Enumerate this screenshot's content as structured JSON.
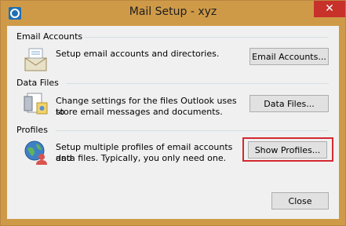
{
  "window": {
    "title": "Mail Setup - xyz",
    "close_glyph": "✕",
    "app_icon": "outlook-app-icon"
  },
  "email_accounts": {
    "group_label": "Email Accounts",
    "description": "Setup email accounts and directories.",
    "button_label": "Email Accounts...",
    "icon": "email-accounts-icon"
  },
  "data_files": {
    "group_label": "Data Files",
    "description_line1": "Change settings for the files Outlook uses to",
    "description_line2": "store email messages and documents.",
    "button_label": "Data Files...",
    "icon": "data-files-icon"
  },
  "profiles": {
    "group_label": "Profiles",
    "description_line1": "Setup multiple profiles of email accounts and",
    "description_line2": "data files. Typically, you only need one.",
    "button_label": "Show Profiles...",
    "icon": "profiles-icon",
    "highlight_color": "#d4282f"
  },
  "footer": {
    "close_label": "Close"
  },
  "colors": {
    "title_bar": "#cf9a48",
    "close_button": "#c7312a",
    "client_bg": "#f0f0f0"
  }
}
